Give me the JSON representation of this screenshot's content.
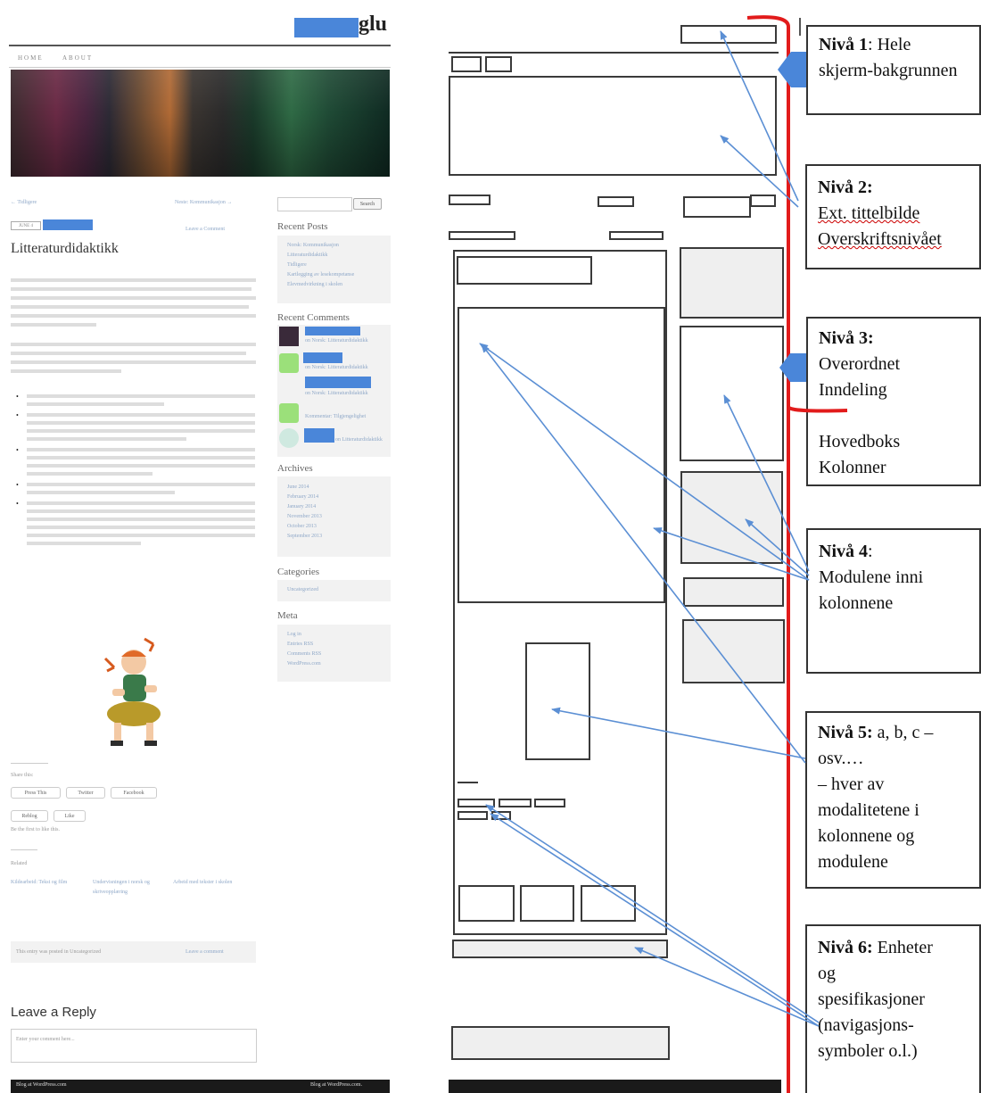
{
  "blog": {
    "site_title": "glu",
    "nav": [
      "HOME",
      "ABOUT"
    ],
    "prev_link": "← Tidligere",
    "next_link": "Neste: Kommunikasjon →",
    "post_date_label": "JUNE 4",
    "post_title": "Litteraturdidaktikk",
    "comment_link": "Leave a Comment",
    "search_button": "Search",
    "widgets": [
      {
        "title": "Recent Posts",
        "items": [
          "Norsk: Kommunikasjon",
          "Litteraturdidaktikk",
          "Tidligere",
          "Kartlegging av lesekompetanse",
          "Elevmedvirkning i skolen"
        ]
      },
      {
        "title": "Recent Comments",
        "items": [
          "on Norsk: Litteraturdidaktikk",
          "on Norsk: Litteraturdidaktikk",
          "on Norsk: Litteraturdidaktikk",
          "Kommentar: Tilgjengelighet",
          "on Litteraturdidaktikk"
        ]
      },
      {
        "title": "Archives",
        "items": [
          "June 2014",
          "February 2014",
          "January 2014",
          "November 2013",
          "October 2013",
          "September 2013"
        ]
      },
      {
        "title": "Categories",
        "items": [
          "Uncategorized"
        ]
      },
      {
        "title": "Meta",
        "items": [
          "Log in",
          "Entries RSS",
          "Comments RSS",
          "WordPress.com"
        ]
      }
    ],
    "share_label": "Share this:",
    "share_buttons": [
      "Press This",
      "Twitter",
      "Facebook"
    ],
    "like_buttons": [
      "Reblog",
      "Like"
    ],
    "like_text": "Be the first to like this.",
    "related_label": "Related",
    "related_posts": [
      "Kildearbeid: Tekst og film",
      "Undervisningen i norsk og skriveopplæring",
      "Arbeid med tekster i skolen"
    ],
    "category_text": "This entry was posted in Uncategorized",
    "leave_comment": "Leave a comment",
    "reply_heading": "Leave a Reply",
    "reply_placeholder": "Enter your comment here...",
    "footer_left": "Blog at WordPress.com",
    "footer_right": "Blog at WordPress.com."
  },
  "levels": [
    {
      "title": "Nivå 1",
      "sep": ": ",
      "text": "Hele skjerm-bakgrunnen"
    },
    {
      "title": "Nivå 2:",
      "lines": [
        "Ext. tittelbilde",
        "Overskriftsnivået"
      ]
    },
    {
      "title": "Nivå 3:",
      "lines": [
        "Overordnet",
        "Inndeling",
        "",
        "Hovedboks",
        "Kolonner"
      ]
    },
    {
      "title": "Nivå 4",
      "sep": ":",
      "lines": [
        "Modulene inni",
        "kolonnene"
      ]
    },
    {
      "title": "Nivå 5:",
      "text": "a, b, c –",
      "lines": [
        "osv.…",
        "– hver av",
        "modalitetene i",
        "kolonnene og",
        "modulene"
      ]
    },
    {
      "title": "Nivå 6:",
      "text": "Enheter",
      "lines": [
        "og",
        "spesifikasjoner",
        "(navigasjons-",
        "symboler o.l.)"
      ]
    }
  ],
  "colors": {
    "red_line": "#e21b1b",
    "arrow_blue": "#5b8fd4",
    "highlight_blue": "#4a86d9",
    "wireframe_stroke": "#3a3a3a",
    "footer_dark": "#1a1a1a"
  }
}
